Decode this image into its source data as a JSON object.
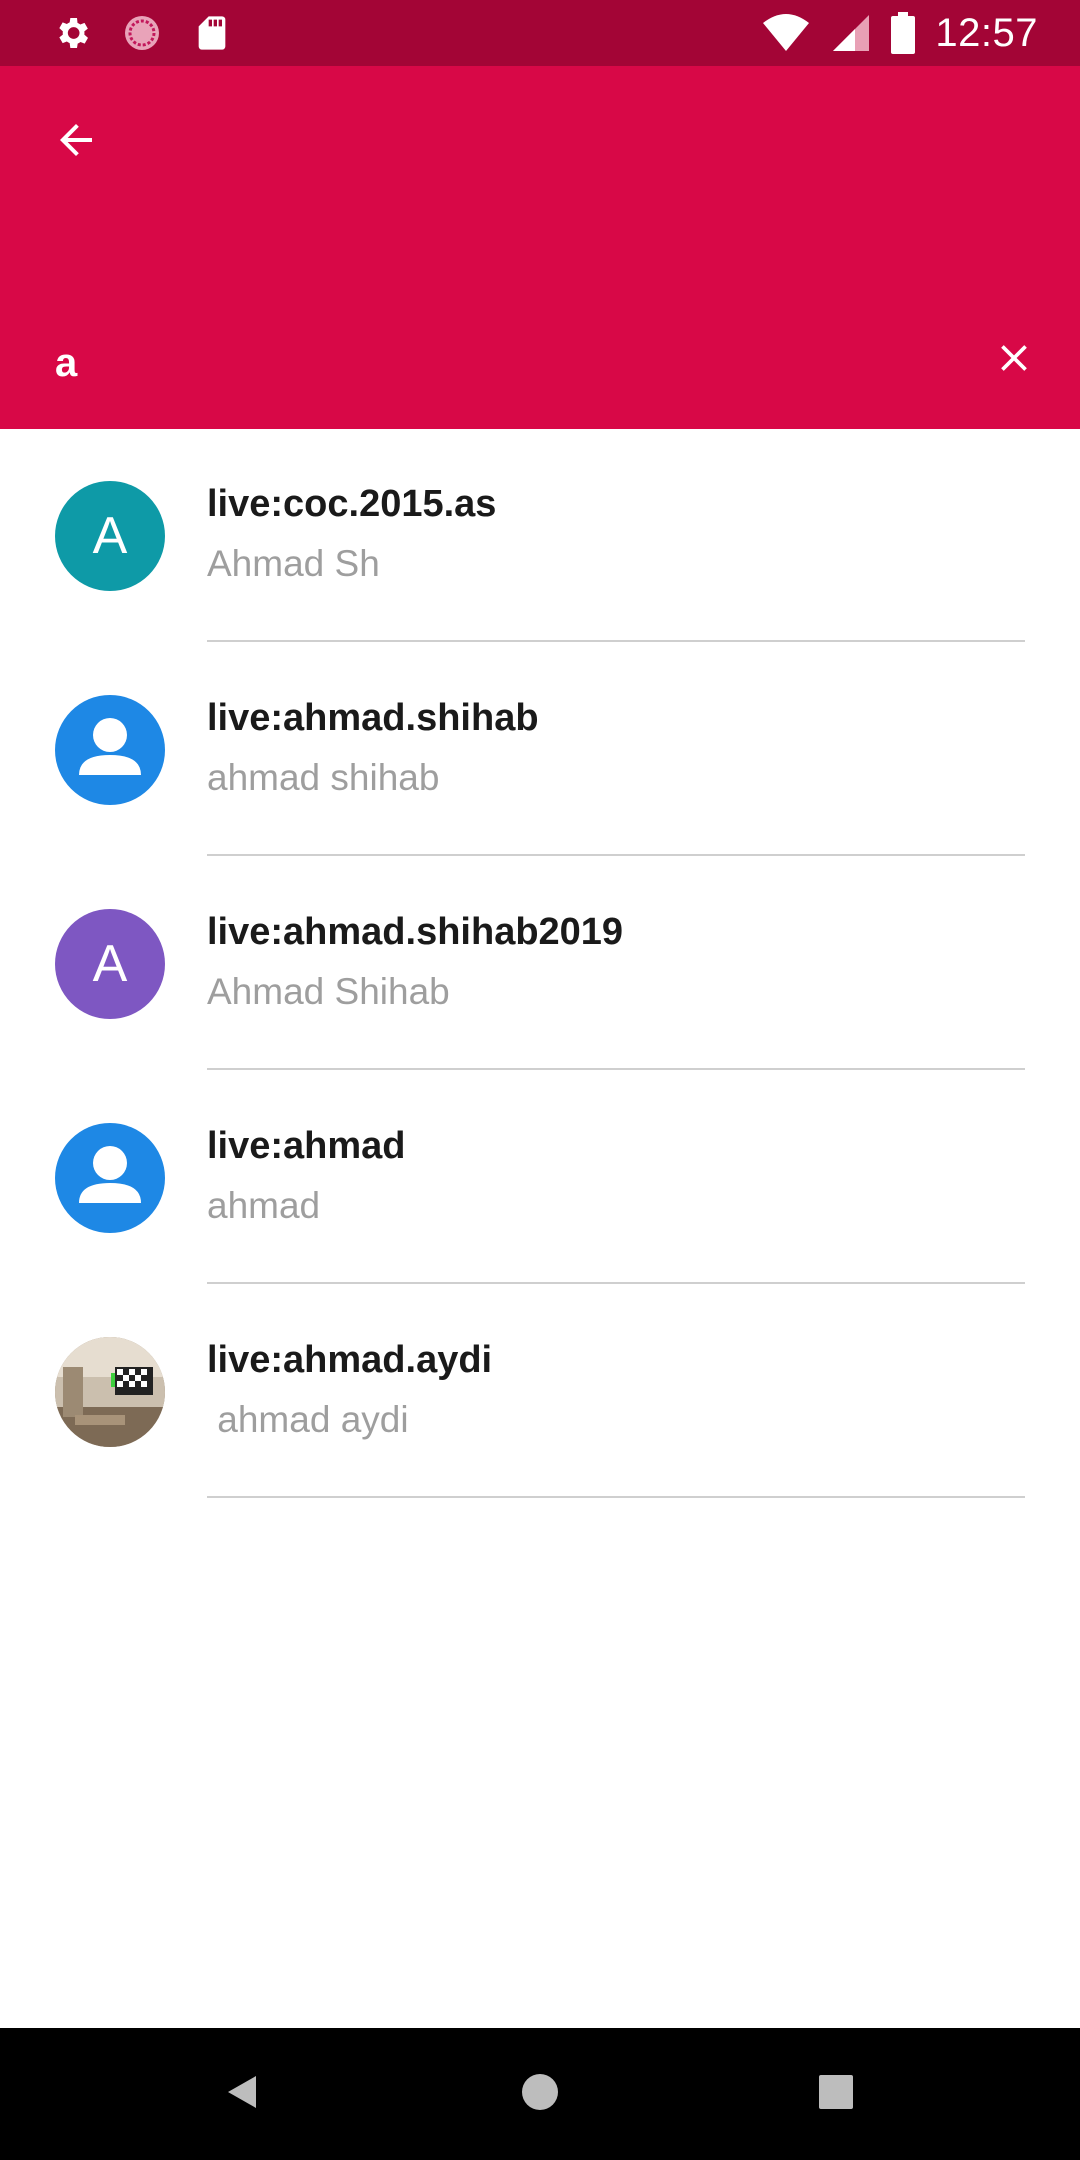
{
  "status_bar": {
    "time": "12:57",
    "icons": [
      "gear-icon",
      "sync-icon",
      "sd-card-icon",
      "wifi-icon",
      "signal-icon",
      "battery-icon"
    ]
  },
  "header": {
    "background": "#d80847",
    "search_value": "a"
  },
  "results": [
    {
      "title": "live:coc.2015.as",
      "subtitle": "Ahmad Sh",
      "avatar": "letter",
      "letter": "A",
      "avatar_color": "#0e9aa7"
    },
    {
      "title": "live:ahmad.shihab",
      "subtitle": "ahmad shihab",
      "avatar": "person",
      "avatar_color": "#1e88e5"
    },
    {
      "title": "live:ahmad.shihab2019",
      "subtitle": "Ahmad Shihab",
      "avatar": "letter",
      "letter": "A",
      "avatar_color": "#7e57c2"
    },
    {
      "title": "live:ahmad",
      "subtitle": "ahmad",
      "avatar": "person",
      "avatar_color": "#1e88e5"
    },
    {
      "title": "live:ahmad.aydi",
      "subtitle": " ahmad aydi",
      "avatar": "photo",
      "avatar_color": "#8d7b67"
    }
  ],
  "nav_bar": {
    "icons": [
      "back-triangle-icon",
      "home-circle-icon",
      "recents-square-icon"
    ]
  }
}
